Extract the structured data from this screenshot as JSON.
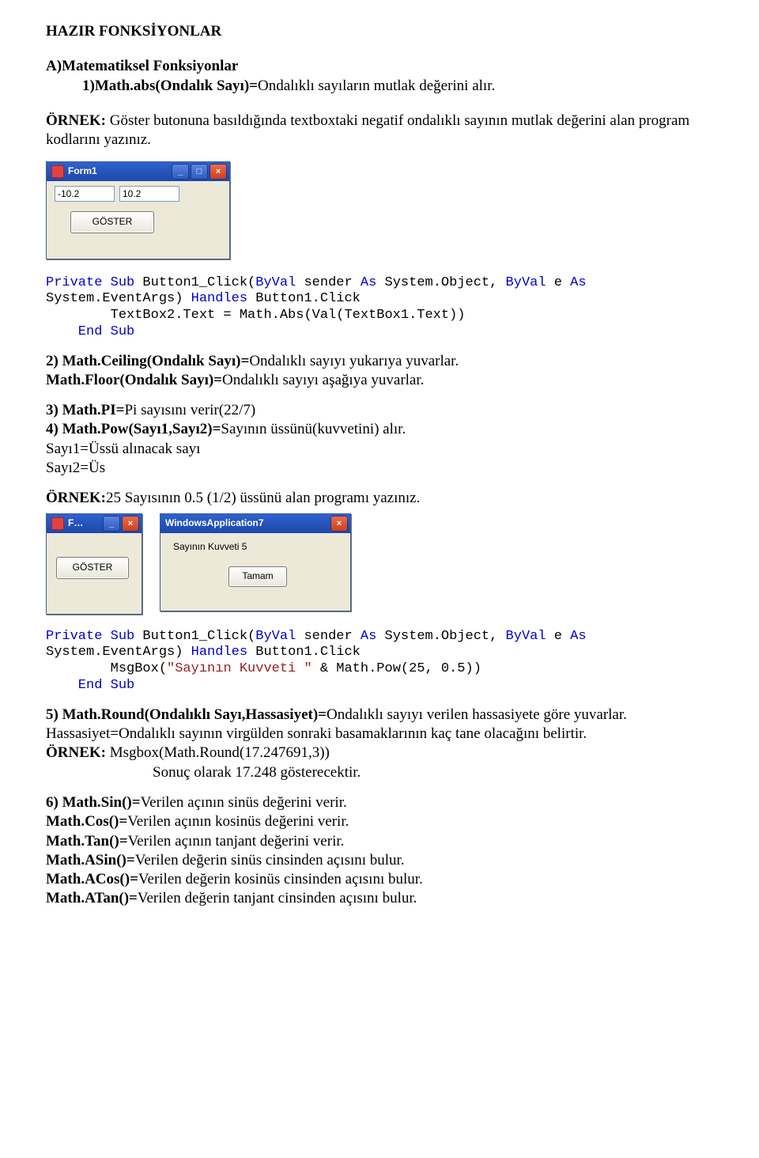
{
  "header": {
    "title": "HAZIR FONKSİYONLAR",
    "secA": "A)Matematiksel Fonksiyonlar",
    "item1_prefix": "1)Math.abs(Ondalık Sayı)=",
    "item1_rest": "Ondalıklı sayıların mutlak değerini alır.",
    "example1_prefix": " ÖRNEK: ",
    "example1_rest": "Göster butonuna basıldığında textboxtaki negatif ondalıklı sayının mutlak değerini alan program kodlarını yazınız."
  },
  "form1": {
    "title": "Form1",
    "tb1": "-10.2",
    "tb2": "10.2",
    "btn": "GÖSTER",
    "min": "_",
    "max": "□",
    "close": "×"
  },
  "code1": {
    "l1a": "Private ",
    "l1b": "Sub",
    "l1c": " Button1_Click(",
    "l1d": "ByVal",
    "l1e": " sender ",
    "l1f": "As",
    "l1g": " System.Object, ",
    "l1h": "ByVal",
    "l1i": " e ",
    "l1j": "As",
    "l2a": "System.EventArgs) ",
    "l2b": "Handles",
    "l2c": " Button1.Click",
    "l3": "        TextBox2.Text = Math.Abs(Val(TextBox1.Text))",
    "l4a": "    End ",
    "l4b": "Sub"
  },
  "item2_prefix": "2) Math.Ceiling(Ondalık Sayı)=",
  "item2_rest": "Ondalıklı sayıyı yukarıya yuvarlar.",
  "item2b_prefix": "Math.Floor(Ondalık Sayı)=",
  "item2b_rest": "Ondalıklı sayıyı aşağıya yuvarlar.",
  "item3_prefix": "3) Math.PI=",
  "item3_rest": "Pi sayısını verir(22/7)",
  "item4_prefix": "4) Math.Pow(Sayı1,Sayı2)=",
  "item4_rest": "Sayının üssünü(kuvvetini) alır.",
  "item4_line2": "Sayı1=Üssü alınacak sayı",
  "item4_line3": "Sayı2=Üs",
  "example2_prefix": "ÖRNEK:",
  "example2_rest": "25 Sayısının 0.5 (1/2) üssünü alan programı yazınız.",
  "fwin": {
    "title": "F…",
    "btn": "GÖSTER",
    "min": "_",
    "close": "×"
  },
  "popup": {
    "title": "WindowsApplication7",
    "text": "Sayının Kuvveti 5",
    "ok": "Tamam",
    "close": "×"
  },
  "code2": {
    "l3a": "        MsgBox(",
    "l3b": "\"Sayının Kuvveti \"",
    "l3c": " & Math.Pow(25, 0.5))"
  },
  "item5_prefix": "5) Math.Round(Ondalıklı Sayı,Hassasiyet)=",
  "item5_rest": "Ondalıklı sayıyı verilen hassasiyete göre yuvarlar.",
  "item5_line2": "Hassasiyet=Ondalıklı sayının virgülden sonraki basamaklarının kaç tane olacağını belirtir.",
  "item5_ex_prefix": "ÖRNEK: ",
  "item5_ex_rest": "Msgbox(Math.Round(17.247691,3))",
  "item5_res": "Sonuç olarak 17.248 gösterecektir.",
  "item6_prefix": "6) Math.Sin()=",
  "item6_rest": "Verilen açının sinüs değerini  verir.",
  "item6_cos_prefix": "Math.Cos()=",
  "item6_cos_rest": "Verilen açının kosinüs değerini  verir.",
  "item6_tan_prefix": "Math.Tan()=",
  "item6_tan_rest": "Verilen açının tanjant değerini  verir.",
  "item6_asin_prefix": "Math.ASin()=",
  "item6_asin_rest": "Verilen değerin sinüs cinsinden açısını bulur.",
  "item6_acos_prefix": "Math.ACos()=",
  "item6_acos_rest": "Verilen değerin kosinüs cinsinden açısını bulur.",
  "item6_atan_prefix": "Math.ATan()=",
  "item6_atan_rest": "Verilen değerin tanjant cinsinden açısını bulur."
}
